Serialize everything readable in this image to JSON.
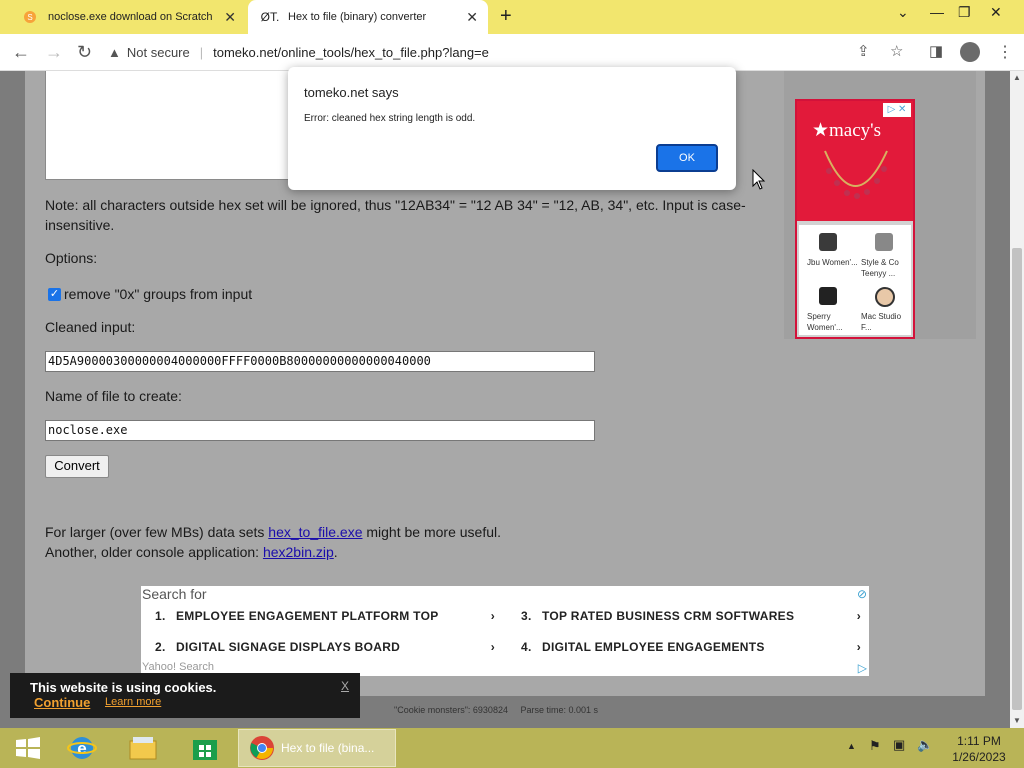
{
  "browser": {
    "tabs": [
      {
        "title": "noclose.exe download on Scratch",
        "favicon": "scratch-icon"
      },
      {
        "title": "Hex to file (binary) converter",
        "favicon_text": "ØT."
      }
    ],
    "not_secure": "Not secure",
    "url": "tomeko.net/online_tools/hex_to_file.php?lang=e"
  },
  "page": {
    "note": "Note: all characters outside hex set will be ignored, thus \"12AB34\" = \"12 AB 34\" = \"12, AB, 34\", etc. Input is case-insensitive.",
    "options_label": "Options:",
    "remove_0x_label": "remove \"0x\" groups from input",
    "cleaned_label": "Cleaned input:",
    "cleaned_value": "4D5A90000300000004000000FFFF0000B80000000000000040000",
    "filename_label": "Name of file to create:",
    "filename_value": "noclose.exe",
    "convert_label": "Convert",
    "larger_prefix": "For larger (over few MBs) data sets ",
    "larger_link": "hex_to_file.exe",
    "larger_suffix": " might be more useful.",
    "older_prefix": "Another, older console application: ",
    "older_link": "hex2bin.zip",
    "older_suffix": "."
  },
  "dialog": {
    "title": "tomeko.net says",
    "message": "Error: cleaned hex string length is odd.",
    "ok_label": "OK"
  },
  "ad_right": {
    "brand": "★macy's",
    "products": [
      {
        "name": "Jbu Women'..."
      },
      {
        "name": "Style & Co Teenyy ..."
      },
      {
        "name": "Sperry Women'..."
      },
      {
        "name": "Mac Studio F..."
      }
    ]
  },
  "ad_bottom": {
    "search_for": "Search for",
    "items": [
      {
        "num": "1.",
        "text": "EMPLOYEE ENGAGEMENT PLATFORM TOP"
      },
      {
        "num": "3.",
        "text": "TOP RATED BUSINESS CRM SOFTWARES"
      },
      {
        "num": "2.",
        "text": "DIGITAL SIGNAGE DISPLAYS BOARD"
      },
      {
        "num": "4.",
        "text": "DIGITAL EMPLOYEE ENGAGEMENTS"
      }
    ],
    "footer": "Yahoo! Search"
  },
  "cookie": {
    "title": "This website is using cookies.",
    "continue": "Continue",
    "learn_more": "Learn more",
    "close": "X"
  },
  "status_line": "\"Cookie monsters\": 6930824     Parse time: 0.001 s",
  "taskbar": {
    "active_window": "Hex to file (bina...",
    "time": "1:11 PM",
    "date": "1/26/2023"
  }
}
